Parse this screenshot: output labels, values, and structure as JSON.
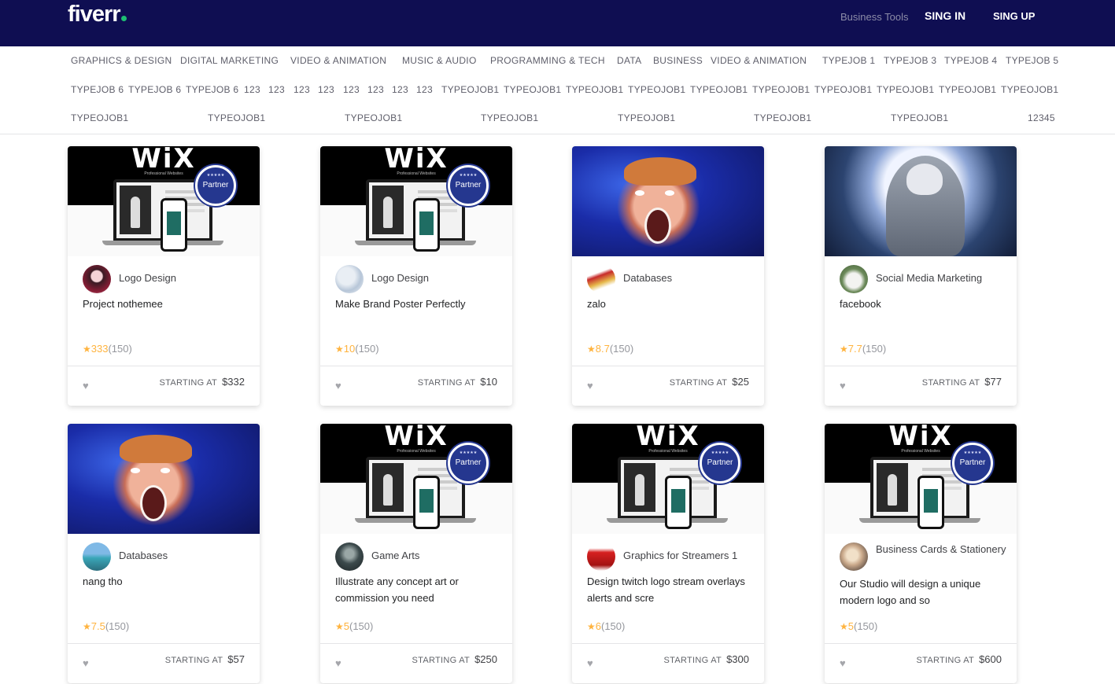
{
  "header": {
    "logo": "fiverr",
    "business_tools": "Business Tools",
    "sign_in": "SING IN",
    "sign_up": "SING UP"
  },
  "categories": {
    "row1": [
      "GRAPHICS & DESIGN",
      "DIGITAL MARKETING",
      "VIDEO & ANIMATION",
      "MUSIC & AUDIO",
      "PROGRAMMING & TECH",
      "DATA",
      "BUSINESS",
      "VIDEO & ANIMATION",
      "TYPEJOB 1",
      "TYPEJOB 3",
      "TYPEJOB 4",
      "TYPEJOB 5"
    ],
    "row2": [
      "TYPEJOB 6",
      "TYPEJOB 6",
      "TYPEJOB 6",
      "123",
      "123",
      "123",
      "123",
      "123",
      "123",
      "123",
      "123",
      "TYPEOJOB1",
      "TYPEOJOB1",
      "TYPEOJOB1",
      "TYPEOJOB1",
      "TYPEOJOB1",
      "TYPEOJOB1",
      "TYPEOJOB1",
      "TYPEOJOB1",
      "TYPEOJOB1",
      "TYPEOJOB1"
    ],
    "row3": [
      "TYPEOJOB1",
      "TYPEOJOB1",
      "TYPEOJOB1",
      "TYPEOJOB1",
      "TYPEOJOB1",
      "TYPEOJOB1",
      "TYPEOJOB1",
      "12345"
    ]
  },
  "wix": {
    "logo": "WiX",
    "subtitle": "Professional Websites",
    "badge": "Partner",
    "badge_stars": "★★★★★"
  },
  "starting_at": "STARTING AT",
  "cards": [
    {
      "image": "wix",
      "avatar": "anime-avatar",
      "category": "Logo Design",
      "title": "Project nothemee",
      "rating": "333",
      "reviews": "(150)",
      "price": "$332"
    },
    {
      "image": "wix",
      "avatar": "design-avatar",
      "category": "Logo Design",
      "title": "Make Brand Poster Perfectly",
      "rating": "10",
      "reviews": "(150)",
      "price": "$10"
    },
    {
      "image": "shocked-face",
      "avatar": "figure-avatar",
      "category": "Databases",
      "title": "zalo",
      "rating": "8.7",
      "reviews": "(150)",
      "price": "$25"
    },
    {
      "image": "moon-knight",
      "avatar": "goat-avatar",
      "category": "Social Media Marketing",
      "title": "facebook",
      "rating": "7.7",
      "reviews": "(150)",
      "price": "$77"
    },
    {
      "image": "shocked-face",
      "avatar": "lake-avatar",
      "category": "Databases",
      "title": "nang tho",
      "rating": "7.5",
      "reviews": "(150)",
      "price": "$57"
    },
    {
      "image": "wix",
      "avatar": "dark-avatar",
      "category": "Game Arts",
      "title": "Illustrate any concept art or commission you need",
      "rating": "5",
      "reviews": "(150)",
      "price": "$250"
    },
    {
      "image": "wix",
      "avatar": "red-dress-avatar",
      "category": "Graphics for Streamers 1",
      "title": "Design twitch logo stream overlays alerts and scre",
      "rating": "6",
      "reviews": "(150)",
      "price": "$300"
    },
    {
      "image": "wix",
      "avatar": "collage-avatar",
      "category": "Business Cards & Stationery",
      "title": "Our Studio will design a unique modern logo and so",
      "rating": "5",
      "reviews": "(150)",
      "price": "$600"
    }
  ],
  "icons": {
    "star": "star-icon",
    "heart": "heart-icon"
  },
  "colors": {
    "header_bg": "#0f0e52",
    "brand_dot": "#1dbf73",
    "star": "#ffb33e",
    "badge": "#25378f"
  }
}
